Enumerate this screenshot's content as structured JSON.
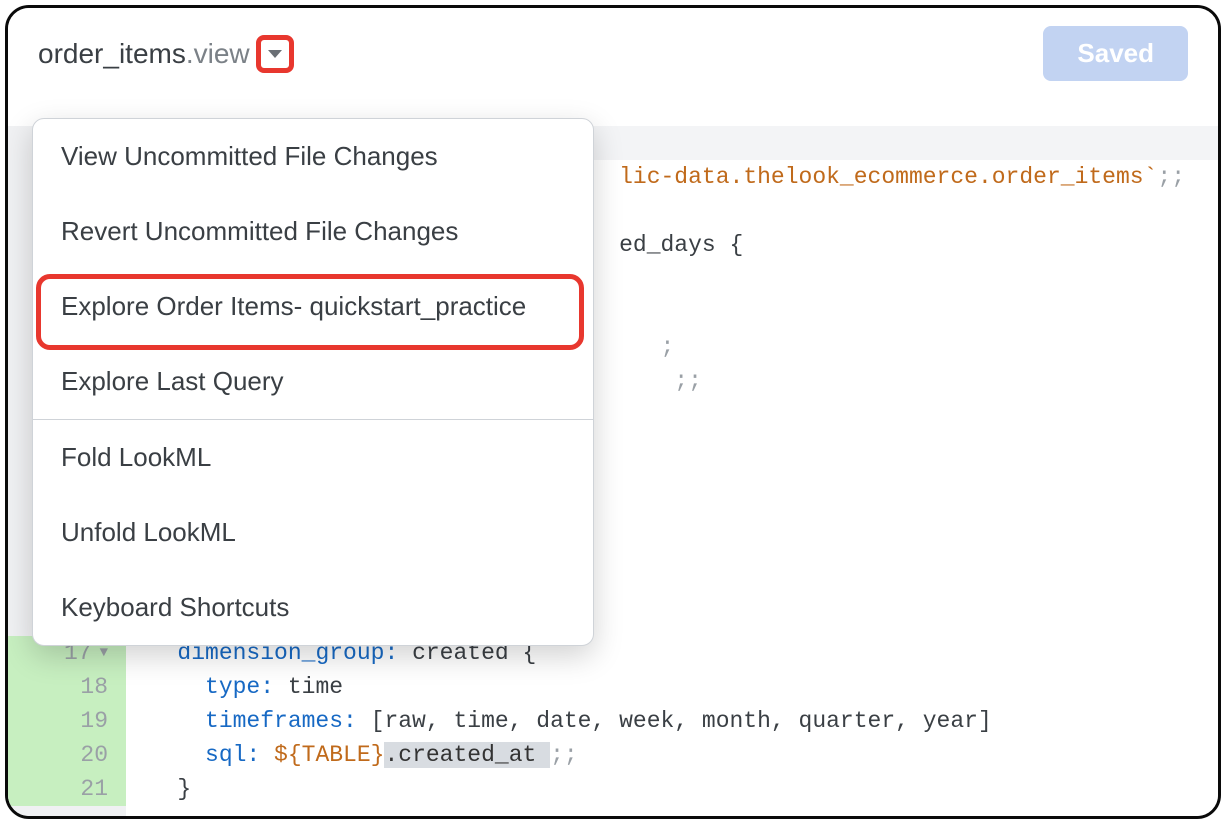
{
  "header": {
    "filename_base": "order_items",
    "filename_ext": ".view",
    "saved_label": "Saved"
  },
  "dropdown": {
    "items": [
      "View Uncommitted File Changes",
      "Revert Uncommitted File Changes",
      "Explore Order Items- quickstart_practice",
      "Explore Last Query",
      "Fold LookML",
      "Unfold LookML",
      "Keyboard Shortcuts"
    ]
  },
  "code": {
    "line2_a": "lic-data.thelook_ecommerce.order_items`",
    "line2_b": ";;",
    "line4_a": "ed_days {",
    "line7_a": ";",
    "line8_a": " ;;",
    "ln17": "17",
    "ln18": "18",
    "ln19": "19",
    "ln20": "20",
    "ln21": "21",
    "l17_kw": "dimension_group:",
    "l17_rest": " created {",
    "l18_kw": "type:",
    "l18_rest": " time",
    "l19_kw": "timeframes:",
    "l19_rest": " [raw, time, date, week, month, quarter, year]",
    "l20_kw": "sql:",
    "l20_var": " ${TABLE}",
    "l20_rest": ".created_at ",
    "l20_term": ";;",
    "l21": "}"
  }
}
